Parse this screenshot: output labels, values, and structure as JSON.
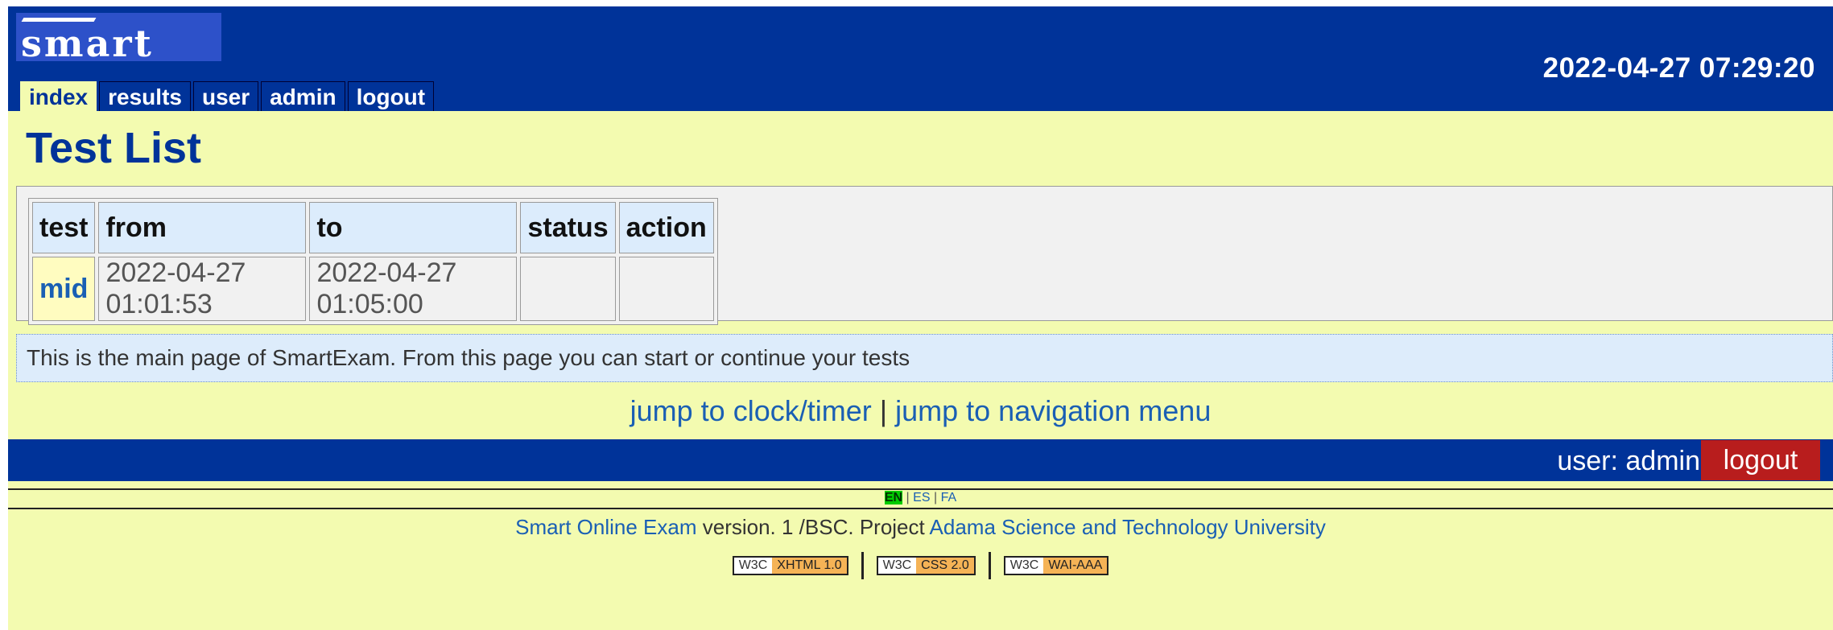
{
  "header": {
    "logo_text": "smart",
    "clock": "2022-04-27 07:29:20",
    "tabs": [
      {
        "label": "index",
        "active": true
      },
      {
        "label": "results"
      },
      {
        "label": "user"
      },
      {
        "label": "admin"
      },
      {
        "label": "logout"
      }
    ]
  },
  "main": {
    "title": "Test List",
    "table": {
      "headers": [
        "test",
        "from",
        "to",
        "status",
        "action"
      ],
      "rows": [
        {
          "test": "mid",
          "from": "2022-04-27 01:01:53",
          "to": "2022-04-27 01:05:00",
          "status": "",
          "action": ""
        }
      ]
    },
    "info": "This is the main page of SmartExam. From this page you can start or continue your tests",
    "jump": {
      "clock_link": "jump to clock/timer",
      "separator": "|",
      "nav_link": "jump to navigation menu"
    }
  },
  "userbar": {
    "label": "user: admin",
    "logout": "logout"
  },
  "footer": {
    "languages": [
      {
        "label": "EN",
        "active": true
      },
      {
        "label": "ES"
      },
      {
        "label": "FA"
      }
    ],
    "lang_separator": "|",
    "product_link": "Smart Online Exam",
    "version_text": " version. 1 /BSC. Project ",
    "university_link": "Adama Science and Technology University",
    "badges": [
      {
        "w3c": "W3C",
        "spec": "XHTML 1.0"
      },
      {
        "w3c": "W3C",
        "spec": "CSS 2.0"
      },
      {
        "w3c": "W3C",
        "spec": "WAI-AAA"
      }
    ]
  },
  "colors": {
    "header_blue": "#003399",
    "page_background": "#f3fbb0",
    "logout_red": "#b81d1d",
    "link_blue": "#1a5fb4",
    "info_background": "#ddecfb"
  }
}
